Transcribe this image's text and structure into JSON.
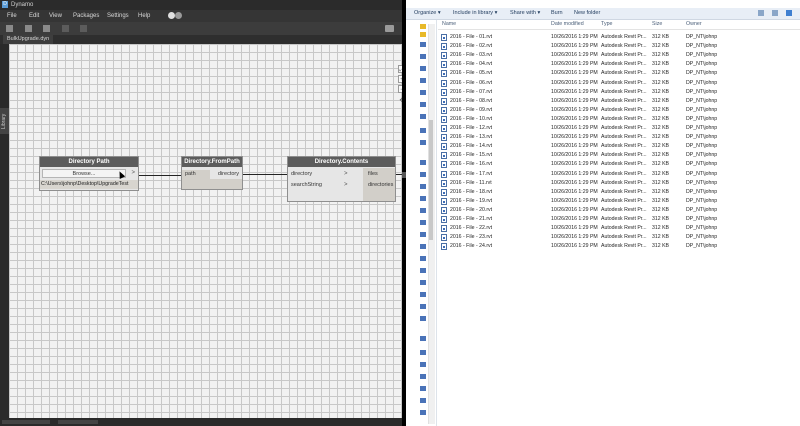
{
  "dynamo": {
    "title": "Dynamo",
    "menu": [
      "File",
      "Edit",
      "View",
      "Packages",
      "Settings",
      "Help"
    ],
    "tab": "BulkUpgrade.dyn",
    "library_label": "Library",
    "zoom_controls": [
      "⤢",
      "+",
      "−",
      "✥"
    ],
    "nodes": {
      "directory_path": {
        "title": "Directory Path",
        "button": "Browse...",
        "output_marker": ">",
        "value": "C:\\Users\\johnp\\Desktop\\UpgradeTest"
      },
      "directory_frompath": {
        "title": "Directory.FromPath",
        "input": "path",
        "output": "directory"
      },
      "directory_contents": {
        "title": "Directory.Contents",
        "inputs": [
          "directory",
          "searchString"
        ],
        "outputs": [
          "files",
          "directories"
        ],
        "chevron": ">"
      }
    },
    "colors": {
      "node_header": "#5c5c5c",
      "canvas": "#f2f2f2",
      "grid": "#c8c8c8"
    }
  },
  "explorer": {
    "toolbar": [
      "Organize ▾",
      "Include in library ▾",
      "Share with ▾",
      "Burn",
      "New folder"
    ],
    "columns": [
      "Name",
      "Date modified",
      "Type",
      "Size",
      "Owner"
    ],
    "files": [
      {
        "name": "2016 - File - 01.rvt",
        "date": "10/26/2016 1:29 PM",
        "type": "Autodesk Revit Pr...",
        "size": "312 KB",
        "owner": "DP_NT\\johnp"
      },
      {
        "name": "2016 - File - 02.rvt",
        "date": "10/26/2016 1:29 PM",
        "type": "Autodesk Revit Pr...",
        "size": "312 KB",
        "owner": "DP_NT\\johnp"
      },
      {
        "name": "2016 - File - 03.rvt",
        "date": "10/26/2016 1:29 PM",
        "type": "Autodesk Revit Pr...",
        "size": "312 KB",
        "owner": "DP_NT\\johnp"
      },
      {
        "name": "2016 - File - 04.rvt",
        "date": "10/26/2016 1:29 PM",
        "type": "Autodesk Revit Pr...",
        "size": "312 KB",
        "owner": "DP_NT\\johnp"
      },
      {
        "name": "2016 - File - 05.rvt",
        "date": "10/26/2016 1:29 PM",
        "type": "Autodesk Revit Pr...",
        "size": "312 KB",
        "owner": "DP_NT\\johnp"
      },
      {
        "name": "2016 - File - 06.rvt",
        "date": "10/26/2016 1:29 PM",
        "type": "Autodesk Revit Pr...",
        "size": "312 KB",
        "owner": "DP_NT\\johnp"
      },
      {
        "name": "2016 - File - 07.rvt",
        "date": "10/26/2016 1:29 PM",
        "type": "Autodesk Revit Pr...",
        "size": "312 KB",
        "owner": "DP_NT\\johnp"
      },
      {
        "name": "2016 - File - 08.rvt",
        "date": "10/26/2016 1:29 PM",
        "type": "Autodesk Revit Pr...",
        "size": "312 KB",
        "owner": "DP_NT\\johnp"
      },
      {
        "name": "2016 - File - 09.rvt",
        "date": "10/26/2016 1:29 PM",
        "type": "Autodesk Revit Pr...",
        "size": "312 KB",
        "owner": "DP_NT\\johnp"
      },
      {
        "name": "2016 - File - 10.rvt",
        "date": "10/26/2016 1:29 PM",
        "type": "Autodesk Revit Pr...",
        "size": "312 KB",
        "owner": "DP_NT\\johnp"
      },
      {
        "name": "2016 - File - 12.rvt",
        "date": "10/26/2016 1:29 PM",
        "type": "Autodesk Revit Pr...",
        "size": "312 KB",
        "owner": "DP_NT\\johnp"
      },
      {
        "name": "2016 - File - 13.rvt",
        "date": "10/26/2016 1:29 PM",
        "type": "Autodesk Revit Pr...",
        "size": "312 KB",
        "owner": "DP_NT\\johnp"
      },
      {
        "name": "2016 - File - 14.rvt",
        "date": "10/26/2016 1:29 PM",
        "type": "Autodesk Revit Pr...",
        "size": "312 KB",
        "owner": "DP_NT\\johnp"
      },
      {
        "name": "2016 - File - 15.rvt",
        "date": "10/26/2016 1:29 PM",
        "type": "Autodesk Revit Pr...",
        "size": "312 KB",
        "owner": "DP_NT\\johnp"
      },
      {
        "name": "2016 - File - 16.rvt",
        "date": "10/26/2016 1:29 PM",
        "type": "Autodesk Revit Pr...",
        "size": "312 KB",
        "owner": "DP_NT\\johnp"
      },
      {
        "name": "2016 - File - 17.rvt",
        "date": "10/26/2016 1:29 PM",
        "type": "Autodesk Revit Pr...",
        "size": "312 KB",
        "owner": "DP_NT\\johnp"
      },
      {
        "name": "2016 - File - 11.rvt",
        "date": "10/26/2016 1:29 PM",
        "type": "Autodesk Revit Pr...",
        "size": "312 KB",
        "owner": "DP_NT\\johnp"
      },
      {
        "name": "2016 - File - 18.rvt",
        "date": "10/26/2016 1:29 PM",
        "type": "Autodesk Revit Pr...",
        "size": "312 KB",
        "owner": "DP_NT\\johnp"
      },
      {
        "name": "2016 - File - 19.rvt",
        "date": "10/26/2016 1:29 PM",
        "type": "Autodesk Revit Pr...",
        "size": "312 KB",
        "owner": "DP_NT\\johnp"
      },
      {
        "name": "2016 - File - 20.rvt",
        "date": "10/26/2016 1:29 PM",
        "type": "Autodesk Revit Pr...",
        "size": "312 KB",
        "owner": "DP_NT\\johnp"
      },
      {
        "name": "2016 - File - 21.rvt",
        "date": "10/26/2016 1:29 PM",
        "type": "Autodesk Revit Pr...",
        "size": "312 KB",
        "owner": "DP_NT\\johnp"
      },
      {
        "name": "2016 - File - 22.rvt",
        "date": "10/26/2016 1:29 PM",
        "type": "Autodesk Revit Pr...",
        "size": "312 KB",
        "owner": "DP_NT\\johnp"
      },
      {
        "name": "2016 - File - 23.rvt",
        "date": "10/26/2016 1:29 PM",
        "type": "Autodesk Revit Pr...",
        "size": "312 KB",
        "owner": "DP_NT\\johnp"
      },
      {
        "name": "2016 - File - 24.rvt",
        "date": "10/26/2016 1:29 PM",
        "type": "Autodesk Revit Pr...",
        "size": "312 KB",
        "owner": "DP_NT\\johnp"
      }
    ]
  }
}
